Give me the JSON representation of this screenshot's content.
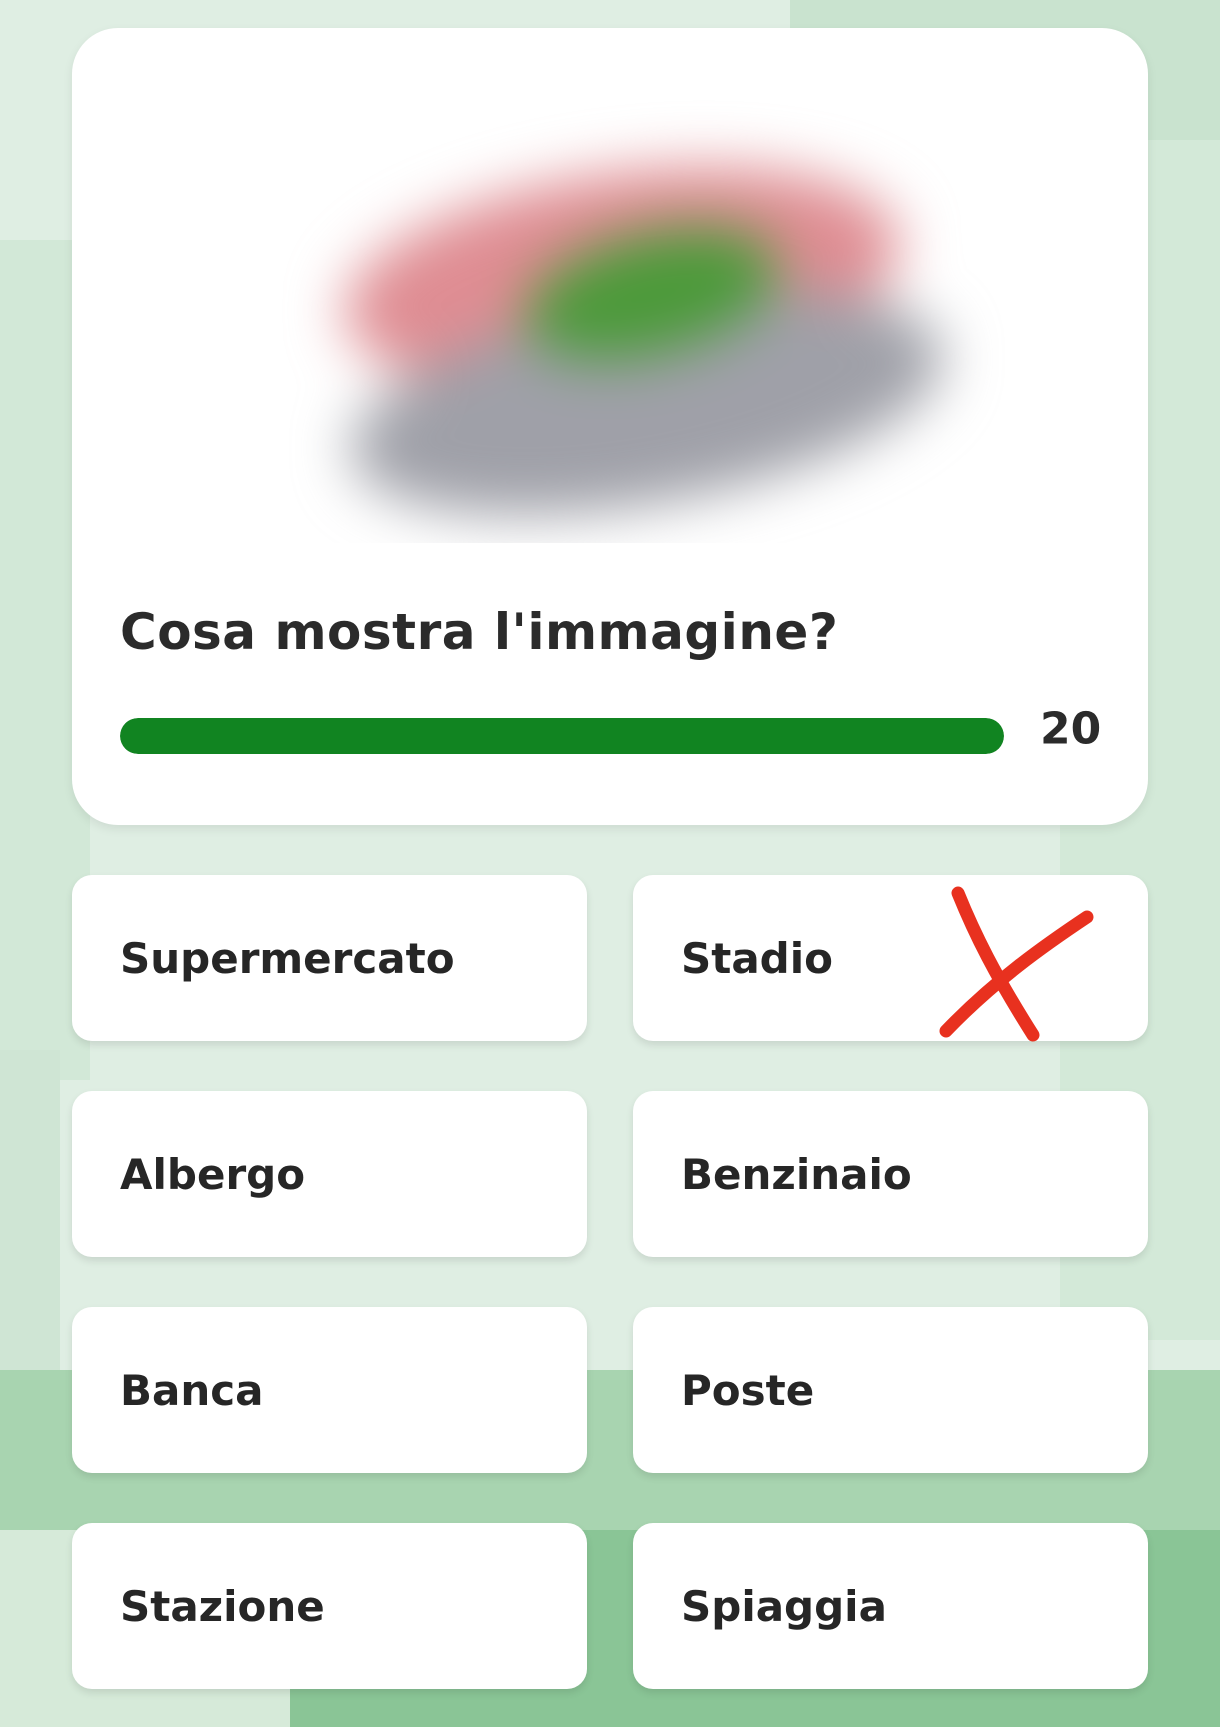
{
  "quiz": {
    "question": "Cosa mostra l'immagine?",
    "timer": "20",
    "progress_fraction": 1.0,
    "image_state": "blurred",
    "image_colors": [
      "#df8d93",
      "#4c9a3a",
      "#9fa0a8"
    ]
  },
  "answers": [
    {
      "label": "Supermercato"
    },
    {
      "label": "Stadio",
      "marked": "wrong"
    },
    {
      "label": "Albergo"
    },
    {
      "label": "Benzinaio"
    },
    {
      "label": "Banca"
    },
    {
      "label": "Poste"
    },
    {
      "label": "Stazione"
    },
    {
      "label": "Spiaggia"
    }
  ],
  "icons": {
    "wrong_mark": "red-cross-icon"
  },
  "colors": {
    "accent_green": "#118421",
    "wrong_red": "#e8311f",
    "card_bg": "#ffffff",
    "page_bg": "#dfeee3"
  }
}
